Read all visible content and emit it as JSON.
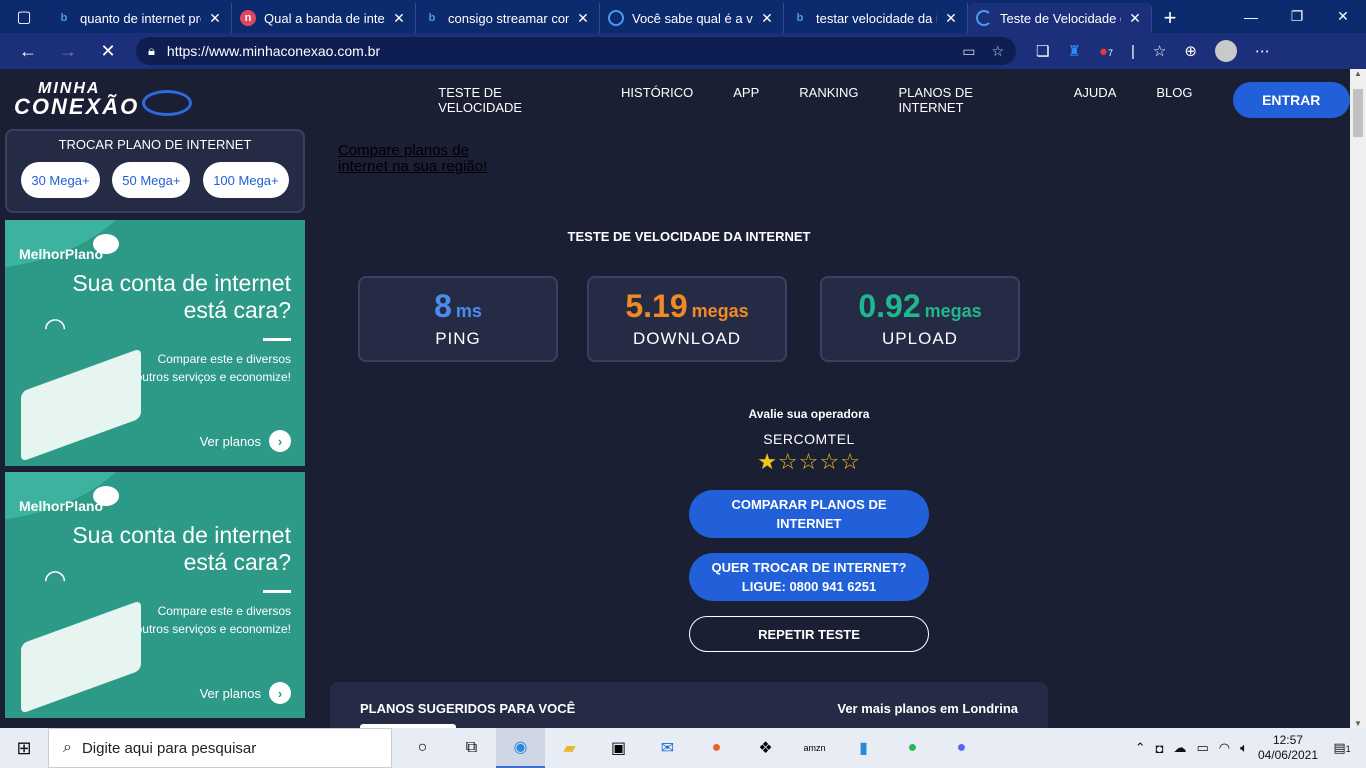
{
  "browser": {
    "tabs": [
      {
        "title": "quanto de internet pre",
        "favicon": "bing-icon",
        "active": false
      },
      {
        "title": "Qual a banda de intern",
        "favicon": "n-icon",
        "active": false
      },
      {
        "title": "consigo streamar com",
        "favicon": "bing-icon",
        "active": false
      },
      {
        "title": "Você sabe qual é a vel",
        "favicon": "globe-icon",
        "active": false
      },
      {
        "title": "testar velocidade da in",
        "favicon": "bing-icon",
        "active": false
      },
      {
        "title": "Teste de Velocidade d",
        "favicon": "loading-icon",
        "active": true
      }
    ],
    "url": "https://www.minhaconexao.com.br",
    "extension_badge": "7"
  },
  "site": {
    "logo_top": "MINHA",
    "logo_bottom": "CONEXÃO",
    "menu": [
      "TESTE DE VELOCIDADE",
      "HISTÓRICO",
      "APP",
      "RANKING",
      "PLANOS DE INTERNET",
      "AJUDA",
      "BLOG"
    ],
    "login_label": "ENTRAR"
  },
  "sidebar": {
    "plan_title": "TROCAR PLANO DE INTERNET",
    "plan_options": [
      "30 Mega+",
      "50 Mega+",
      "100 Mega+"
    ],
    "ads": [
      {
        "brand": "MelhorPlano",
        "headline": "Sua conta de internet está cara?",
        "desc": "Compare este e diversos outros serviços e economize!",
        "cta": "Ver planos"
      },
      {
        "brand": "MelhorPlano",
        "headline": "Sua conta de internet está cara?",
        "desc": "Compare este e diversos outros serviços e economize!",
        "cta": "Ver planos"
      }
    ]
  },
  "main": {
    "compare_link": "Compare planos de internet na sua região!",
    "speed_title": "TESTE DE VELOCIDADE DA INTERNET",
    "metrics": [
      {
        "value": "8",
        "unit": "ms",
        "label": "PING",
        "color": "#4a8cf0"
      },
      {
        "value": "5.19",
        "unit": "megas",
        "label": "DOWNLOAD",
        "color": "#f08a24"
      },
      {
        "value": "0.92",
        "unit": "megas",
        "label": "UPLOAD",
        "color": "#1fb88e"
      }
    ],
    "rate_prompt": "Avalie sua operadora",
    "operator": "SERCOMTEL",
    "stars": "★☆☆☆☆",
    "rating": 1,
    "buttons": [
      {
        "label": "COMPARAR PLANOS DE INTERNET",
        "style": "blue"
      },
      {
        "label": "QUER TROCAR DE INTERNET? LIGUE: 0800 941 6251",
        "style": "blue"
      },
      {
        "label": "REPETIR TESTE",
        "style": "outline"
      }
    ],
    "suggest_title": "PLANOS SUGERIDOS PARA VOCÊ",
    "suggest_link": "Ver mais planos em Londrina"
  },
  "taskbar": {
    "search_placeholder": "Digite aqui para pesquisar",
    "apps": [
      "cortana-icon",
      "task-view-icon",
      "edge-icon",
      "file-explorer-icon",
      "store-icon",
      "mail-icon",
      "firefox-icon",
      "dropbox-icon",
      "amazon-icon",
      "phone-icon",
      "spotify-icon",
      "discord-icon"
    ],
    "time": "12:57",
    "date": "04/06/2021",
    "notification_count": "1"
  },
  "colors": {
    "accent": "#2160d8",
    "tabbar": "#0c2a6e",
    "page_bg": "#1b1f33"
  }
}
